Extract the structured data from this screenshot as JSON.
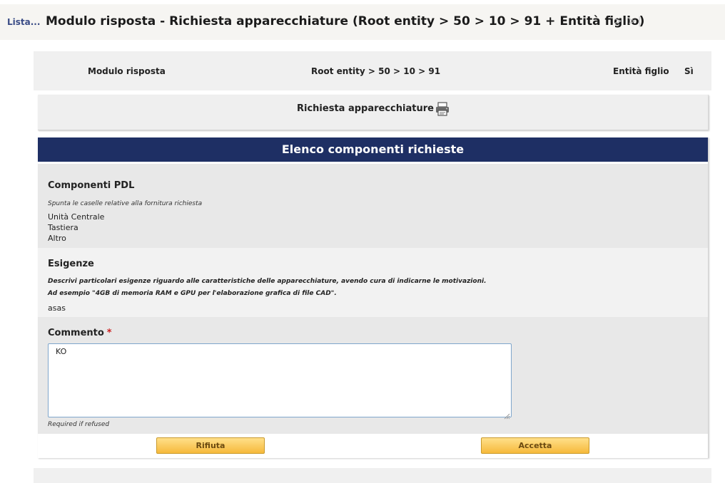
{
  "header": {
    "back_link": "Lista...",
    "title": "Modulo risposta - Richiesta apparecchiature (Root entity > 50 > 10 > 91 + Entità figlio)",
    "nav_arrows": "> >|"
  },
  "summary": {
    "form": "Modulo risposta",
    "root_path": "Root entity > 50 > 10 > 91",
    "child_entity_label": "Entità figlio",
    "child_entity_value": "Sì"
  },
  "request": {
    "title": "Richiesta apparecchiature",
    "print_icon": "printer-icon"
  },
  "panel": {
    "title": "Elenco componenti richieste",
    "components": {
      "title": "Componenti PDL",
      "hint": "Spunta le caselle relative alla fornitura richiesta",
      "items": [
        "Unità Centrale",
        "Tastiera",
        "Altro"
      ]
    },
    "needs": {
      "title": "Esigenze",
      "hint_line1": "Descrivi particolari esigenze riguardo alle caratteristiche delle apparecchiature, avendo cura di indicarne le motivazioni.",
      "hint_line2": "Ad esempio \"4GB di memoria RAM e GPU per l'elaborazione grafica di file CAD\".",
      "value": "asas"
    },
    "comment": {
      "title": "Commento",
      "required_mark": "*",
      "value": "KO",
      "note": "Required if refused"
    },
    "buttons": {
      "refuse": "Rifiuta",
      "accept": "Accetta"
    }
  },
  "colors": {
    "header_bar": "#1e2f64",
    "button_gradient_top": "#ffe08a",
    "button_gradient_bottom": "#f6b93b",
    "required": "#cc1f1f",
    "link": "#3a4c86"
  }
}
